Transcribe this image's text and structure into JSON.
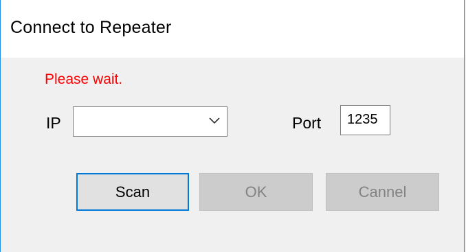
{
  "window": {
    "title": "Connect to Repeater"
  },
  "status": {
    "message": "Please wait.",
    "color": "#ff0000"
  },
  "form": {
    "ip_label": "IP",
    "ip_value": "",
    "port_label": "Port",
    "port_value": "1235"
  },
  "buttons": {
    "scan_label": "Scan",
    "ok_label": "OK",
    "cancel_label": "Cannel"
  },
  "icons": {
    "dropdown": "chevron-down-icon"
  },
  "colors": {
    "accent": "#0078d7",
    "window_border": "#1e8ee6"
  }
}
